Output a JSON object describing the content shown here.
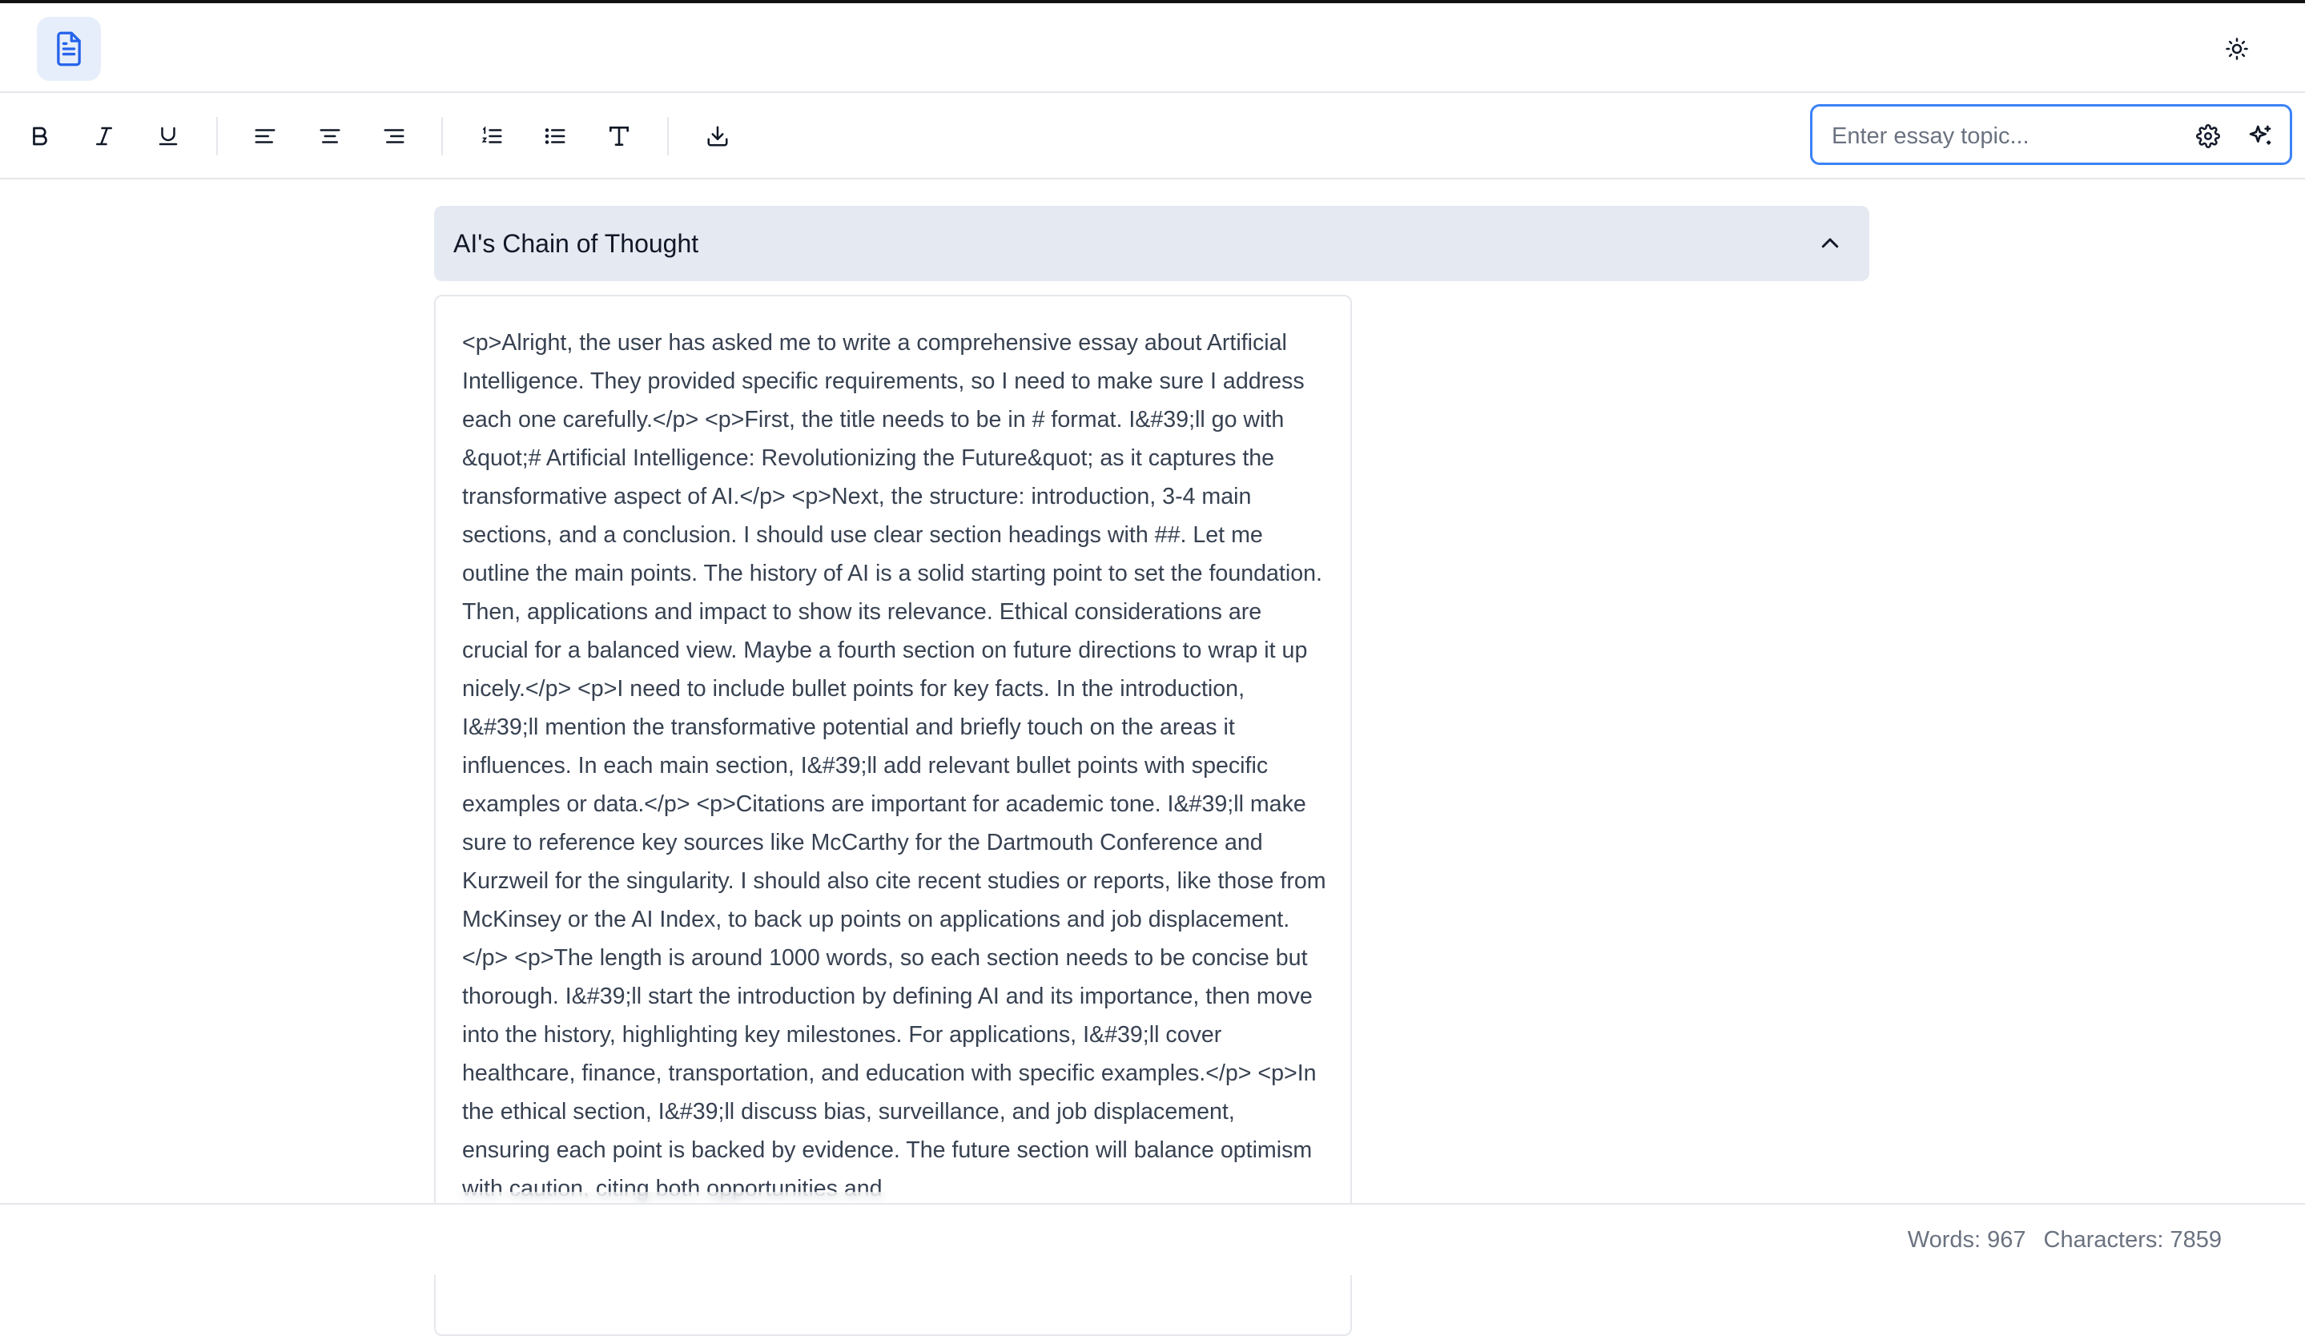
{
  "toolbar": {
    "buttons": [
      {
        "name": "bold",
        "icon": "bold-icon"
      },
      {
        "name": "italic",
        "icon": "italic-icon"
      },
      {
        "name": "underline",
        "icon": "underline-icon"
      },
      {
        "name": "align-left",
        "icon": "align-left-icon"
      },
      {
        "name": "align-center",
        "icon": "align-center-icon"
      },
      {
        "name": "align-right",
        "icon": "align-right-icon"
      },
      {
        "name": "ordered-list",
        "icon": "ordered-list-icon"
      },
      {
        "name": "bullet-list",
        "icon": "bullet-list-icon"
      },
      {
        "name": "text-style",
        "icon": "text-icon"
      },
      {
        "name": "download",
        "icon": "download-icon"
      }
    ],
    "topic_placeholder": "Enter essay topic...",
    "topic_value": ""
  },
  "chain_of_thought": {
    "title": "AI's Chain of Thought",
    "expanded": true,
    "text": "<p>Alright, the user has asked me to write a comprehensive essay about Artificial Intelligence. They provided specific requirements, so I need to make sure I address each one carefully.</p> <p>First, the title needs to be in # format. I&#39;ll go with &quot;# Artificial Intelligence: Revolutionizing the Future&quot; as it captures the transformative aspect of AI.</p> <p>Next, the structure: introduction, 3-4 main sections, and a conclusion. I should use clear section headings with ##. Let me outline the main points. The history of AI is a solid starting point to set the foundation. Then, applications and impact to show its relevance. Ethical considerations are crucial for a balanced view. Maybe a fourth section on future directions to wrap it up nicely.</p> <p>I need to include bullet points for key facts. In the introduction, I&#39;ll mention the transformative potential and briefly touch on the areas it influences. In each main section, I&#39;ll add relevant bullet points with specific examples or data.</p> <p>Citations are important for academic tone. I&#39;ll make sure to reference key sources like McCarthy for the Dartmouth Conference and Kurzweil for the singularity. I should also cite recent studies or reports, like those from McKinsey or the AI Index, to back up points on applications and job displacement.</p> <p>The length is around 1000 words, so each section needs to be concise but thorough. I&#39;ll start the introduction by defining AI and its importance, then move into the history, highlighting key milestones. For applications, I&#39;ll cover healthcare, finance, transportation, and education with specific examples.</p> <p>In the ethical section, I&#39;ll discuss bias, surveillance, and job displacement, ensuring each point is backed by evidence. The future section will balance optimism with caution, citing both opportunities and"
  },
  "footer": {
    "words": "Words: 967",
    "characters": "Characters: 7859"
  },
  "colors": {
    "accent": "#3b82f6",
    "logo_bg": "#e6eefb",
    "cot_header_bg": "#e5e9f1"
  }
}
